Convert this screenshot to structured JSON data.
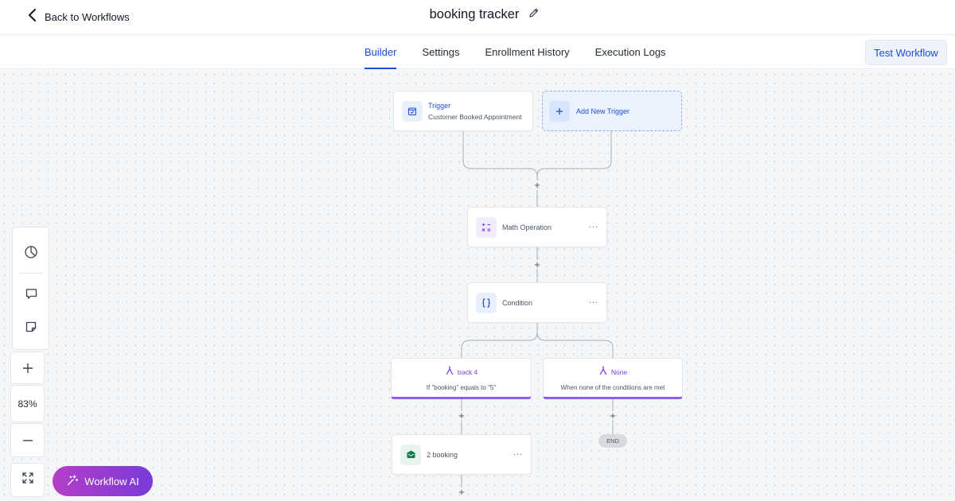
{
  "header": {
    "back_label": "Back to Workflows",
    "workflow_name": "booking tracker"
  },
  "tabs": [
    {
      "label": "Builder",
      "active": true
    },
    {
      "label": "Settings",
      "active": false
    },
    {
      "label": "Enrollment History",
      "active": false
    },
    {
      "label": "Execution Logs",
      "active": false
    }
  ],
  "test_button_label": "Test Workflow",
  "canvas": {
    "trigger": {
      "title": "Trigger",
      "subtitle": "Customer Booked Appointment",
      "icon": "calendar-check-icon"
    },
    "add_trigger": {
      "label": "Add New Trigger",
      "icon": "plus-icon"
    },
    "actions": [
      {
        "label": "Math Operation",
        "icon": "math-operations-icon"
      },
      {
        "label": "Condition",
        "icon": "curly-braces-icon"
      },
      {
        "label": "2 booking",
        "icon": "envelope-icon"
      }
    ],
    "branches": [
      {
        "name": "track 4",
        "condition": "If \"booking\" equals to \"5\"",
        "icon": "branch-icon"
      },
      {
        "name": "None",
        "condition": "When none of the conditions are met",
        "icon": "branch-icon"
      }
    ],
    "end_label": "END",
    "more_label": "···",
    "plus_label": "+"
  },
  "toolbar": {
    "tools": [
      "pie-chart-icon",
      "comment-icon",
      "sticky-note-icon"
    ],
    "zoom_in": "+",
    "zoom_level": "83%",
    "zoom_out": "−",
    "fit": "fullscreen-icon"
  },
  "ai_button_label": "Workflow AI",
  "colors": {
    "accent_blue": "#1d4ed8",
    "branch_purple": "#8b5cf6",
    "ai_gradient_start": "#b43ec9",
    "ai_gradient_end": "#7a3ad8"
  }
}
